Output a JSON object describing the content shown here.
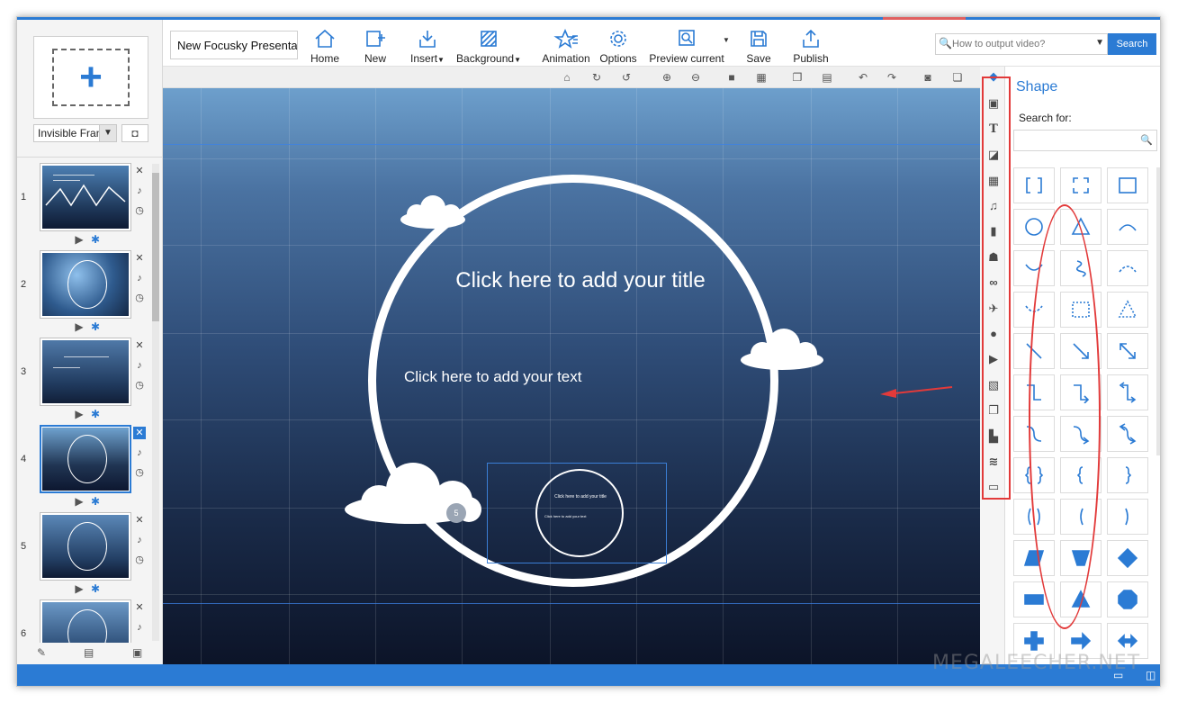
{
  "toolbar": {
    "project_title": "New Focusky Presenta",
    "buttons": [
      {
        "label": "Home",
        "icon": "home-icon"
      },
      {
        "label": "New",
        "icon": "new-frame-icon"
      },
      {
        "label": "Insert",
        "icon": "insert-icon"
      },
      {
        "label": "Background",
        "icon": "background-icon"
      },
      {
        "label": "Animation",
        "icon": "animation-icon"
      },
      {
        "label": "Options",
        "icon": "gear-icon"
      },
      {
        "label": "Preview current",
        "icon": "preview-icon"
      },
      {
        "label": "Save",
        "icon": "save-icon"
      },
      {
        "label": "Publish",
        "icon": "publish-icon"
      }
    ],
    "search_placeholder": "How to output video?",
    "search_button": "Search"
  },
  "left_panel": {
    "frame_type": "Invisible Fran",
    "thumbnails": [
      {
        "number": "1",
        "selected": false
      },
      {
        "number": "2",
        "selected": false
      },
      {
        "number": "3",
        "selected": false
      },
      {
        "number": "4",
        "selected": true
      },
      {
        "number": "5",
        "selected": false
      },
      {
        "number": "6",
        "selected": false
      }
    ]
  },
  "canvas": {
    "title_placeholder": "Click here to add your title",
    "text_placeholder": "Click here to add your text",
    "inner_title": "Click here to add your title",
    "inner_text": "Click here to add your text",
    "frame_badge": "5"
  },
  "right_panel": {
    "title": "Shape",
    "search_label": "Search for:",
    "category_icons": [
      "frame-icon",
      "image-icon",
      "text-icon",
      "shape-icon",
      "video-icon",
      "music-icon",
      "chart-icon",
      "people-icon",
      "link-icon",
      "plane-icon",
      "flash-icon",
      "doc-icon",
      "gallery-icon",
      "copy-icon",
      "layout-icon",
      "layers-icon",
      "stack-icon"
    ]
  },
  "status": {
    "watermark": "MEGALEECHER.NET"
  },
  "colors": {
    "accent": "#2b7bd4",
    "highlight": "#e23a3a"
  }
}
